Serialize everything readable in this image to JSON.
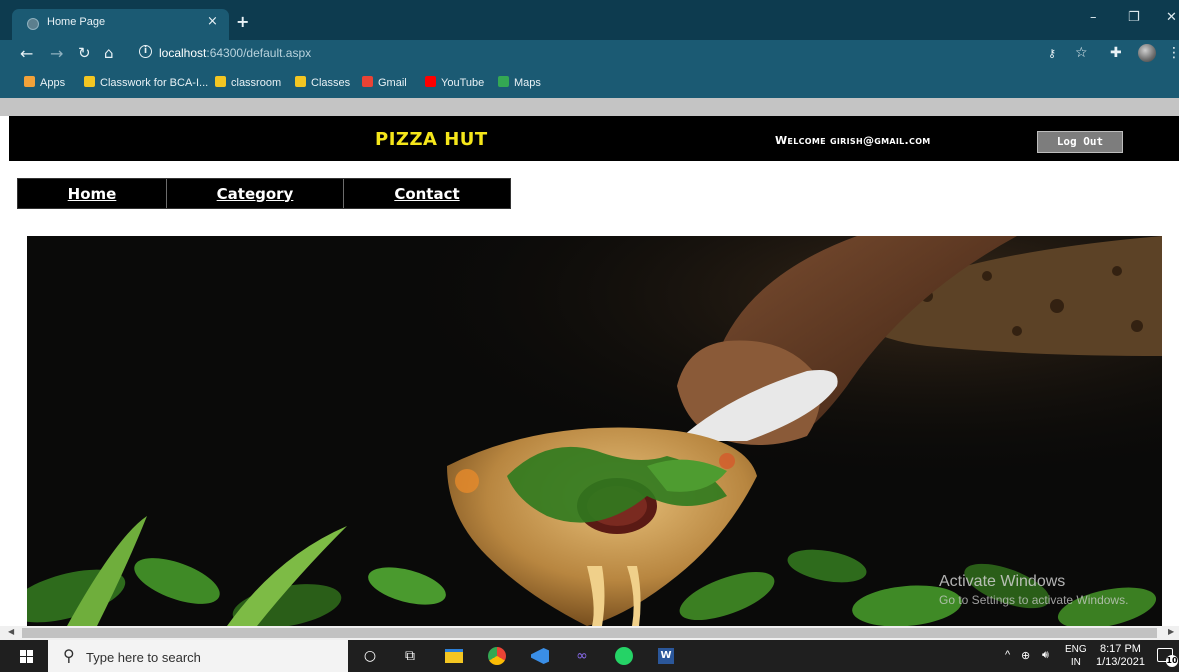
{
  "browser": {
    "tab_title": "Home Page",
    "tab_close": "×",
    "new_tab": "+",
    "window_minimize": "–",
    "window_restore": "❐",
    "window_close": "✕",
    "url_host": "localhost",
    "url_path": ":64300/default.aspx",
    "bookmarks": [
      {
        "label": "Apps",
        "icon": "apps-grid-icon",
        "color": "#f2a23a"
      },
      {
        "label": "Classwork for BCA-I...",
        "icon": "classroom-icon",
        "color": "#f3c622"
      },
      {
        "label": "classroom",
        "icon": "folder-icon",
        "color": "#f3c622"
      },
      {
        "label": "Classes",
        "icon": "classroom-icon",
        "color": "#f3c622"
      },
      {
        "label": "Gmail",
        "icon": "gmail-icon",
        "color": "#ea4335"
      },
      {
        "label": "YouTube",
        "icon": "youtube-icon",
        "color": "#ff0000"
      },
      {
        "label": "Maps",
        "icon": "maps-icon",
        "color": "#34a853"
      }
    ]
  },
  "page": {
    "brand": "PIZZA HUT",
    "brand_color": "#f5e61a",
    "welcome": "Welcome girish@gmail.com",
    "logout": "Log Out",
    "menu": [
      "Home",
      "Category",
      "Contact"
    ]
  },
  "watermark": {
    "title": "Activate Windows",
    "subtitle": "Go to Settings to activate Windows."
  },
  "taskbar": {
    "search_placeholder": "Type here to search",
    "lang_top": "ENG",
    "lang_bottom": "IN",
    "time": "8:17 PM",
    "date": "1/13/2021",
    "notifications": "10"
  }
}
